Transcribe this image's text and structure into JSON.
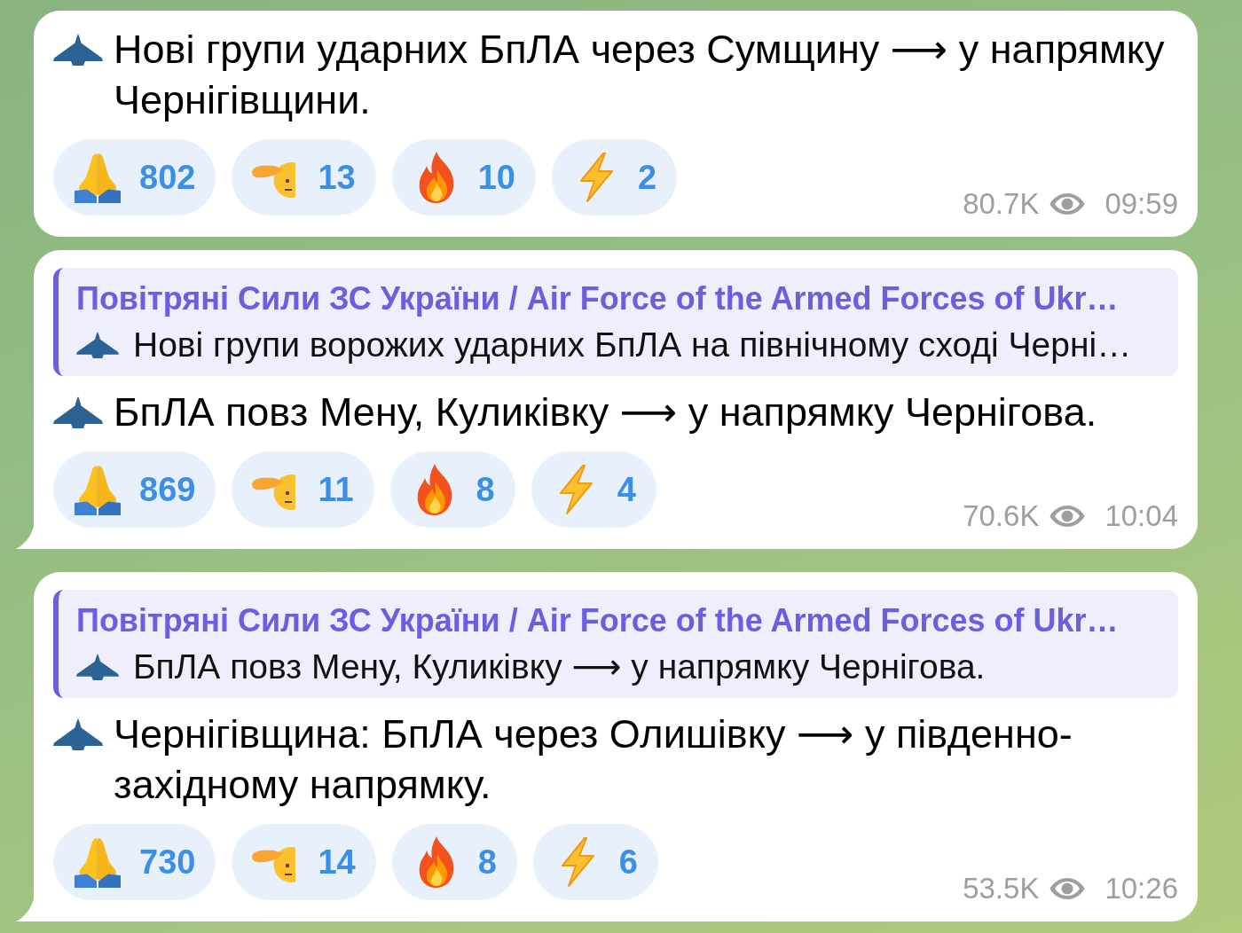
{
  "groups": [
    {
      "messages": [
        {
          "text": "Нові групи ударних БпЛА через Сумщину ⟶ у напрямку Чернігівщини.",
          "reactions": [
            {
              "kind": "pray",
              "count": "802"
            },
            {
              "kind": "salute",
              "count": "13"
            },
            {
              "kind": "fire",
              "count": "10"
            },
            {
              "kind": "lightning",
              "count": "2"
            }
          ],
          "views": "80.7K",
          "time": "09:59"
        },
        {
          "reply": {
            "author": "Повітряні Сили ЗС України / Air Force of the Armed Forces of Ukr…",
            "text": "Нові групи ворожих ударних БпЛА на північному сході Черні…"
          },
          "text": "БпЛА повз Мену, Куликівку ⟶ у напрямку Чернігова.",
          "reactions": [
            {
              "kind": "pray",
              "count": "869"
            },
            {
              "kind": "salute",
              "count": "11"
            },
            {
              "kind": "fire",
              "count": "8"
            },
            {
              "kind": "lightning",
              "count": "4"
            }
          ],
          "views": "70.6K",
          "time": "10:04"
        }
      ]
    },
    {
      "messages": [
        {
          "reply": {
            "author": "Повітряні Сили ЗС України / Air Force of the Armed Forces of Ukr…",
            "text": "БпЛА повз Мену, Куликівку ⟶ у напрямку Чернігова."
          },
          "text": "Чернігівщина: БпЛА через Олишівку ⟶ у південно-західному напрямку.",
          "reactions": [
            {
              "kind": "pray",
              "count": "730"
            },
            {
              "kind": "salute",
              "count": "14"
            },
            {
              "kind": "fire",
              "count": "8"
            },
            {
              "kind": "lightning",
              "count": "6"
            }
          ],
          "views": "53.5K",
          "time": "10:26"
        }
      ]
    }
  ]
}
